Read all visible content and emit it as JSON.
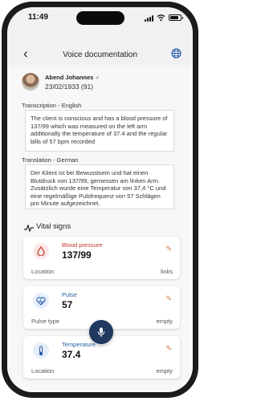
{
  "status_bar": {
    "time": "11:49"
  },
  "header": {
    "title": "Voice documentation"
  },
  "patient": {
    "name": "Abend Johannes",
    "gender_symbol": "♂",
    "birth": "23/02/1933 (91)"
  },
  "transcription": {
    "label": "Transcription - English",
    "text": "The client is conscious and has a blood pressure of 137/99 which was measured on the left arm additionally the temperature of 37.4 and the regular bills of 57 bpm recorded"
  },
  "translation": {
    "label": "Translation - German",
    "text": "Der Klient ist bei Bewusstsein und hat einen Blutdruck von 137/99, gemessen am linken Arm. Zusätzlich wurde eine Temperatur von 37,4 °C und eine regelmäßige Pulsfrequenz von 57 Schlägen pro Minute aufgezeichnet."
  },
  "vitals": {
    "title": "Vital signs",
    "cards": [
      {
        "label": "Blood pressure",
        "value": "137/99",
        "bottom_left": "Location",
        "bottom_right": "links",
        "icon": "droplet-icon",
        "color": "#c0392b",
        "icon_bg": "#fbe6e6"
      },
      {
        "label": "Pulse",
        "value": "57",
        "bottom_left": "Pulse type",
        "bottom_right": "empty",
        "icon": "heart-pulse-icon",
        "color": "#2b5fa8",
        "icon_bg": "#e6eefa"
      },
      {
        "label": "Temperature",
        "value": "37.4",
        "bottom_left": "Location",
        "bottom_right": "empty",
        "icon": "thermometer-icon",
        "color": "#2b5fa8",
        "icon_bg": "#e6eefa"
      }
    ]
  },
  "colors": {
    "accent": "#d07a3f",
    "mic_button": "#1f3a5e"
  }
}
